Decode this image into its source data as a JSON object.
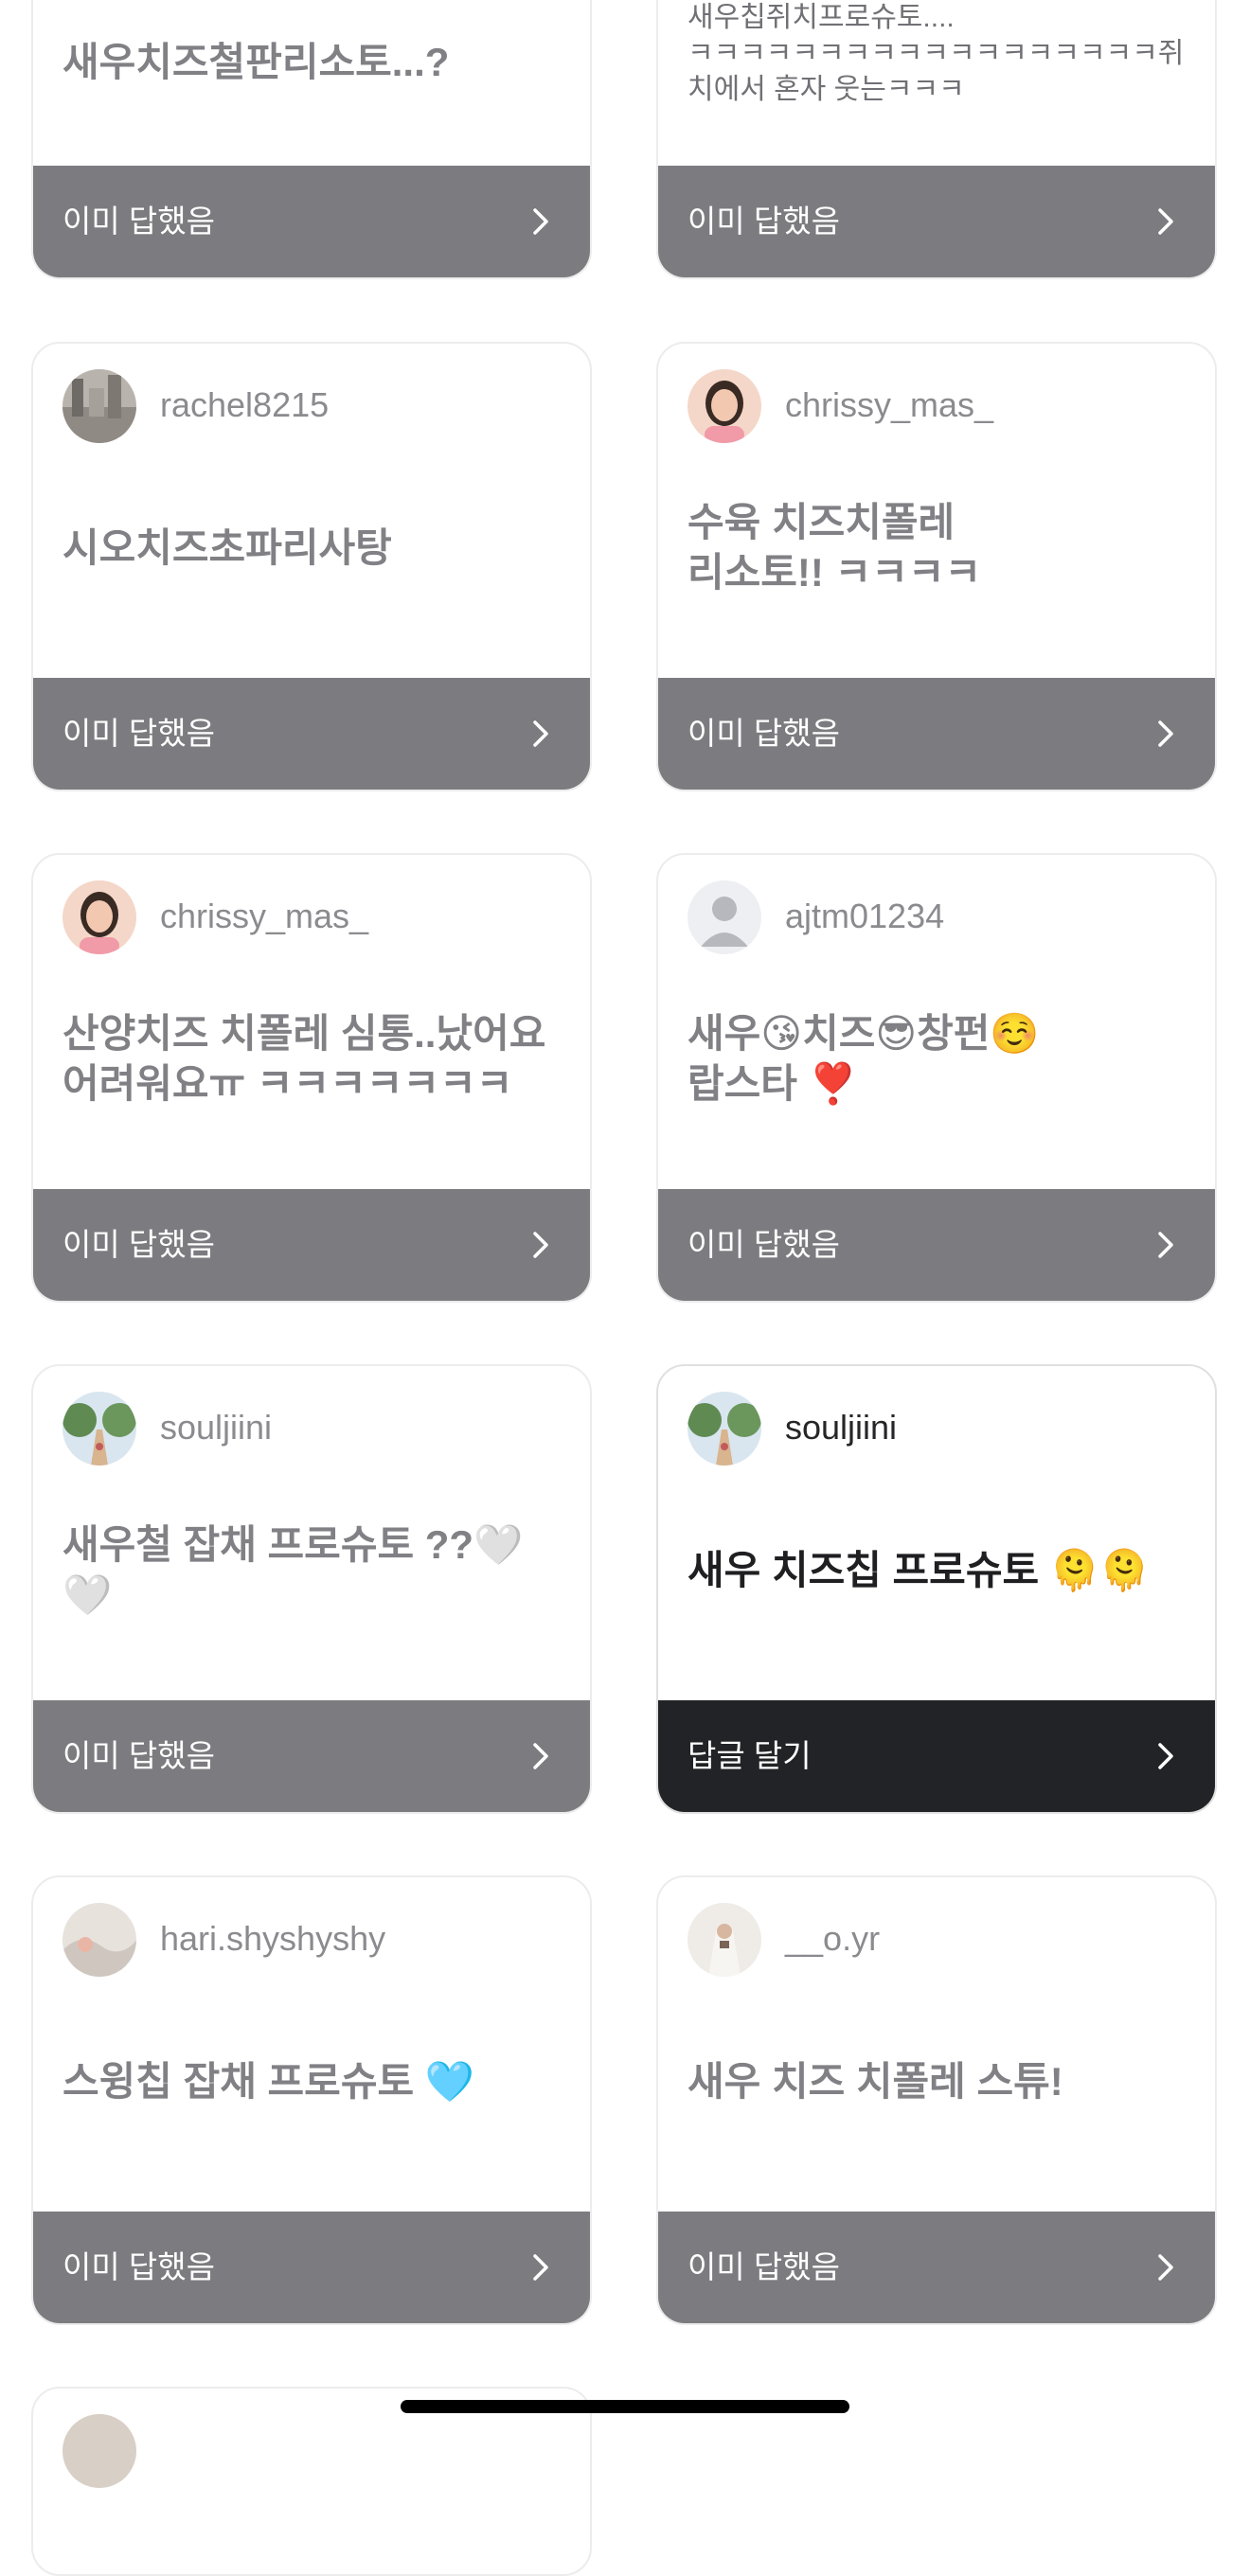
{
  "cards": [
    {
      "username": "",
      "message": "새우치즈철판리소토...?",
      "footer": "이미 답했음",
      "avatar": ""
    },
    {
      "username": "",
      "message": "새우칩쥐치프로슈토....\nㅋㅋㅋㅋㅋㅋㅋㅋㅋㅋㅋㅋㅋㅋㅋㅋㅋㅋ쥐치에서 혼자 웃는ㅋㅋㅋ",
      "footer": "이미 답했음",
      "avatar": ""
    },
    {
      "username": "rachel8215",
      "message": "시오치즈초파리사탕",
      "footer": "이미 답했음",
      "avatar": "city-photo-avatar"
    },
    {
      "username": "chrissy_mas_",
      "message": "수육 치즈치폴레\n리소토!! ㅋㅋㅋㅋ",
      "footer": "이미 답했음",
      "avatar": "woman-portrait-avatar"
    },
    {
      "username": "chrissy_mas_",
      "message": "산양치즈 치폴레 심통..났어요 어려워요ㅠ ㅋㅋㅋㅋㅋㅋㅋ",
      "footer": "이미 답했음",
      "avatar": "woman-portrait-avatar"
    },
    {
      "username": "ajtm01234",
      "message": "새우😘치즈😎창펀☺️\n랍스타 ❣️",
      "footer": "이미 답했음",
      "avatar": "default-person-avatar"
    },
    {
      "username": "souljiini",
      "message": "새우철 잡채 프로슈토 ??🤍🤍",
      "footer": "이미 답했음",
      "avatar": "tree-path-avatar"
    },
    {
      "username": "souljiini",
      "message": "새우 치즈칩 프로슈토 🫠🫠",
      "footer": "답글 달기",
      "avatar": "tree-path-avatar"
    },
    {
      "username": "hari.shyshyshy",
      "message": "스윙칩 잡채 프로슈토 🩵",
      "footer": "이미 답했음",
      "avatar": "fabric-photo-avatar"
    },
    {
      "username": "__o.yr",
      "message": "새우 치즈 치폴레 스튜!",
      "footer": "이미 답했음",
      "avatar": "bride-photo-avatar"
    }
  ],
  "colors": {
    "answered_footer": "#7c7c80",
    "reply_footer": "#222326",
    "card_border": "#ececec"
  },
  "icons": {
    "chevron": "chevron-right-icon"
  }
}
